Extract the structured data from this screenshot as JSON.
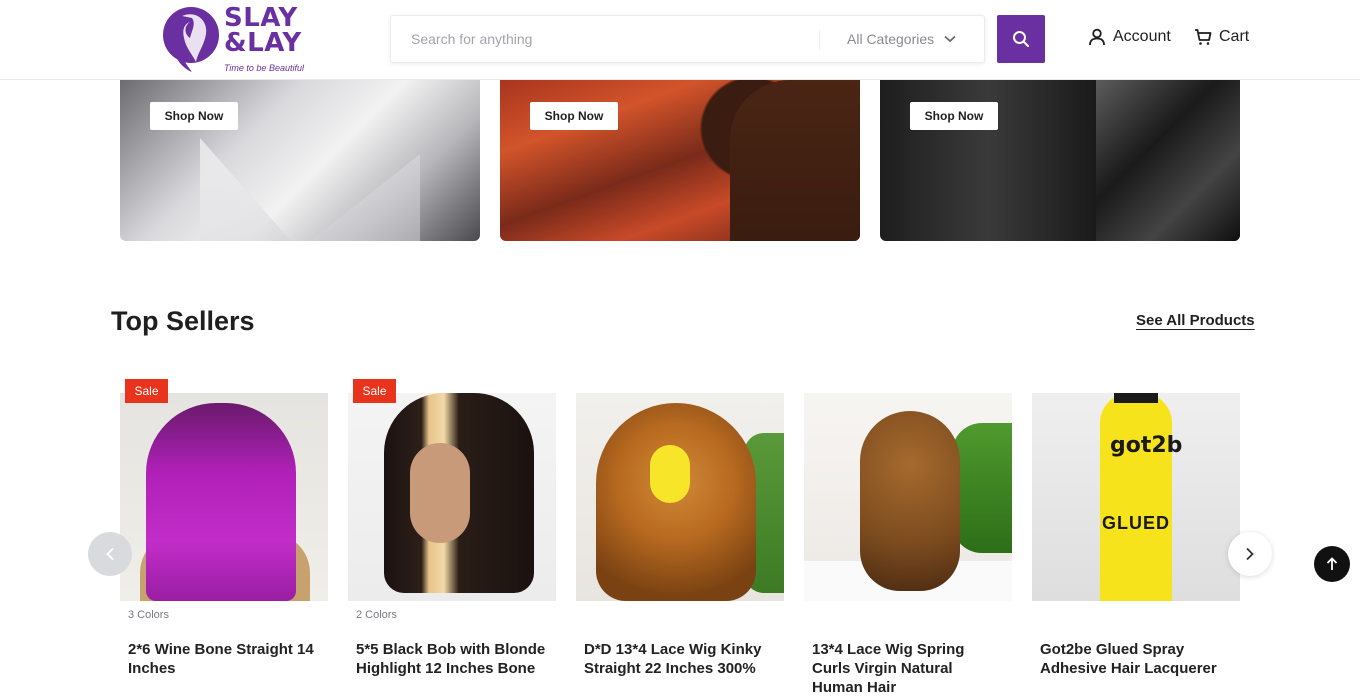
{
  "brand": {
    "name_line1": "SLAY",
    "name_line2": "&LAY",
    "tagline": "Time to be Beautiful",
    "color": "#6a2fa0"
  },
  "header": {
    "search_placeholder": "Search for anything",
    "category_label": "All Categories",
    "account_label": "Account",
    "cart_label": "Cart"
  },
  "banners": [
    {
      "cta": "Shop Now"
    },
    {
      "cta": "Shop Now"
    },
    {
      "cta": "Shop Now"
    }
  ],
  "section": {
    "title": "Top Sellers",
    "see_all": "See All Products"
  },
  "products": [
    {
      "badge": "Sale",
      "colors": "3 Colors",
      "name": "2*6 Wine Bone Straight 14 Inches"
    },
    {
      "badge": "Sale",
      "colors": "2 Colors",
      "name": "5*5 Black Bob with Blonde Highlight 12 Inches Bone"
    },
    {
      "badge": "",
      "colors": "",
      "name": "D*D 13*4 Lace Wig Kinky Straight 22 Inches 300%"
    },
    {
      "badge": "",
      "colors": "",
      "name": "13*4 Lace Wig Spring Curls Virgin Natural Human Hair"
    },
    {
      "badge": "",
      "colors": "",
      "name": "Got2be Glued Spray Adhesive Hair Lacquerer"
    }
  ],
  "product_art": {
    "can_brand": "got2b",
    "can_label": "GLUED"
  },
  "icons": {
    "search": "search-icon",
    "chevron": "chevron-down-icon",
    "account": "user-icon",
    "cart": "cart-icon",
    "prev": "chevron-left-icon",
    "next": "chevron-right-icon",
    "top": "arrow-up-icon"
  },
  "colors": {
    "accent": "#6a2fa0",
    "sale": "#e8341c"
  }
}
